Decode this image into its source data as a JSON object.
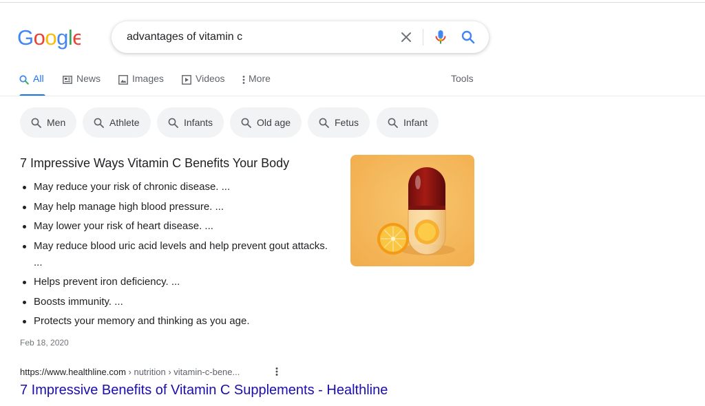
{
  "logo": {
    "text": "Google"
  },
  "search": {
    "query": "advantages of vitamin c",
    "placeholder": ""
  },
  "tabs": [
    {
      "label": "All",
      "icon": "search-icon",
      "active": true
    },
    {
      "label": "News",
      "icon": "news-icon"
    },
    {
      "label": "Images",
      "icon": "image-icon"
    },
    {
      "label": "Videos",
      "icon": "video-icon"
    },
    {
      "label": "More",
      "icon": "more-vert-icon"
    }
  ],
  "tools_label": "Tools",
  "chips": [
    "Men",
    "Athlete",
    "Infants",
    "Old age",
    "Fetus",
    "Infant"
  ],
  "snippet": {
    "title": "7 Impressive Ways Vitamin C Benefits Your Body",
    "items": [
      "May reduce your risk of chronic disease. ...",
      "May help manage high blood pressure. ...",
      "May lower your risk of heart disease. ...",
      "May reduce blood uric acid levels and help prevent gout attacks. ...",
      "Helps prevent iron deficiency. ...",
      "Boosts immunity. ...",
      "Protects your memory and thinking as you age."
    ],
    "date": "Feb 18, 2020",
    "image": "vitamin-capsule-with-orange-image"
  },
  "result": {
    "cite_domain": "https://www.healthline.com",
    "cite_path": " › nutrition › vitamin-c-bene...",
    "title": "7 Impressive Benefits of Vitamin C Supplements - Healthline"
  },
  "colors": {
    "link": "#1a0dab",
    "accent": "#1a73e8",
    "chip_bg": "#f1f3f4",
    "image_bg": "#f5b659"
  }
}
